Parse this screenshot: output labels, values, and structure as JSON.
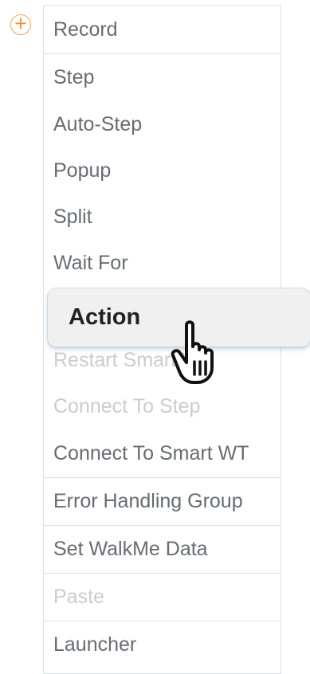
{
  "add_icon": "+",
  "menu": {
    "items": [
      {
        "label": "Record",
        "disabled": false
      },
      {
        "label": "Step",
        "disabled": false
      },
      {
        "label": "Auto-Step",
        "disabled": false
      },
      {
        "label": "Popup",
        "disabled": false
      },
      {
        "label": "Split",
        "disabled": false
      },
      {
        "label": "Wait For",
        "disabled": false
      },
      {
        "label": "Restart Smart WT",
        "disabled": true
      },
      {
        "label": "Connect To Step",
        "disabled": true
      },
      {
        "label": "Connect To Smart WT",
        "disabled": false
      },
      {
        "label": "Error Handling Group",
        "disabled": false
      },
      {
        "label": "Set WalkMe Data",
        "disabled": false
      },
      {
        "label": "Paste",
        "disabled": true
      },
      {
        "label": "Launcher",
        "disabled": false
      }
    ],
    "hovered_item": {
      "label": "Action"
    }
  },
  "colors": {
    "accent_orange": "#f08a2e",
    "text": "#666c72",
    "disabled_text": "#c9cdd1",
    "border": "#d6e2ea"
  }
}
